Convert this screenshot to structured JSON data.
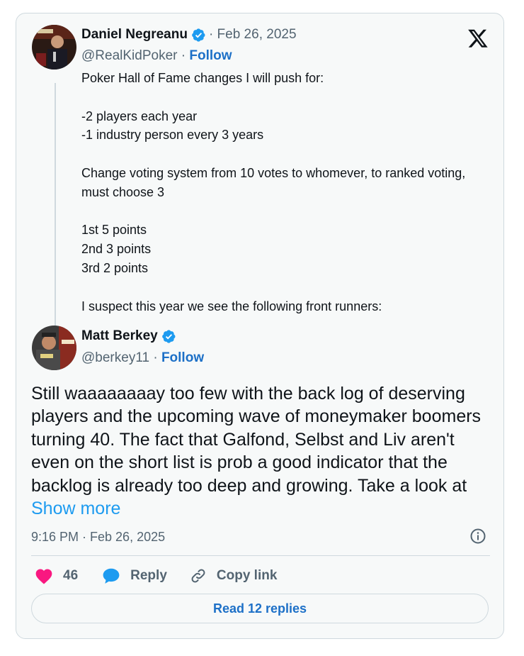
{
  "quoted_tweet": {
    "author_name": "Daniel Negreanu",
    "date": "· Feb 26, 2025",
    "handle": "@RealKidPoker",
    "separator": " · ",
    "follow_label": "Follow",
    "text": "Poker Hall of Fame changes I will push for:\n\n-2 players each year\n-1 industry person every 3 years\n\nChange voting system from 10 votes to whomever, to ranked voting, must choose 3\n\n1st 5 points\n2nd 3 points\n3rd 2 points\n\nI suspect this year we see the following front runners:"
  },
  "main_tweet": {
    "author_name": "Matt Berkey",
    "handle": "@berkey11",
    "separator": " · ",
    "follow_label": "Follow",
    "text": "Still waaaaaaaay too few with the back log of deserving players and the upcoming wave of moneymaker boomers turning 40. The fact that Galfond, Selbst and Liv aren't even on the short list is prob a good indicator that the backlog is already too deep and growing. Take a look at",
    "show_more_label": "Show more",
    "timestamp": "9:16 PM · Feb 26, 2025"
  },
  "actions": {
    "like_count": "46",
    "reply_label": "Reply",
    "copy_link_label": "Copy link"
  },
  "read_replies_label": "Read 12 replies",
  "icons": [
    "x-logo-icon",
    "verified-badge-icon",
    "info-icon",
    "heart-icon",
    "reply-bubble-icon",
    "link-icon"
  ],
  "colors": {
    "accent": "#1d9bf0",
    "follow": "#1d70c7",
    "like": "#f91880",
    "muted": "#536471",
    "border": "#cfd9de",
    "card_background": "#f7f9f9"
  }
}
